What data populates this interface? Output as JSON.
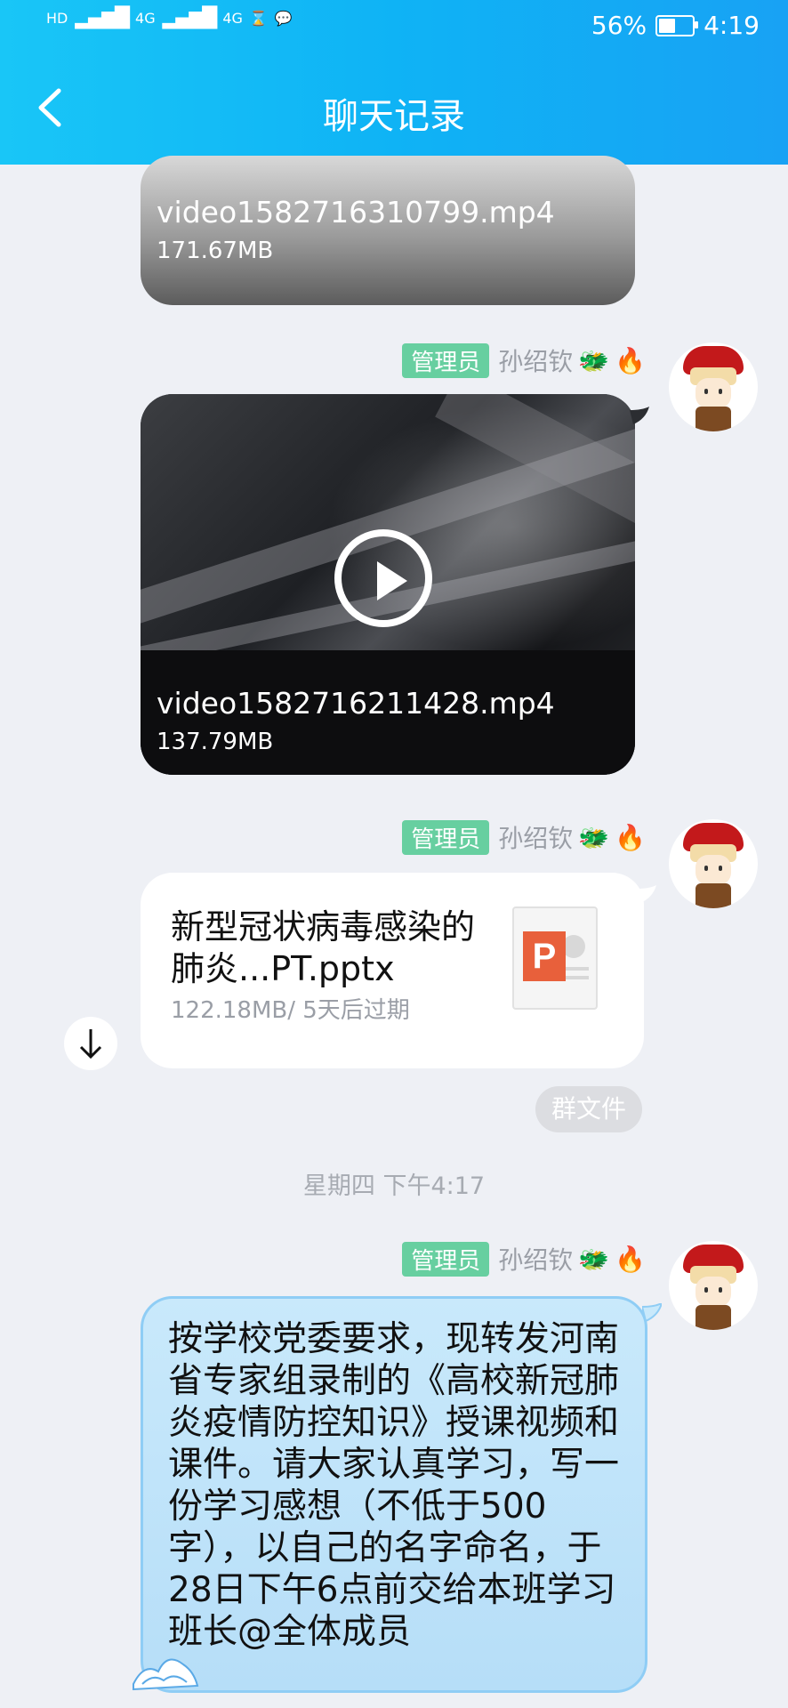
{
  "status_bar": {
    "left_labels": [
      "HD",
      "4G",
      "4G"
    ],
    "battery": "56%",
    "battery_level": 0.56,
    "time": "4:19"
  },
  "header": {
    "title": "聊天记录",
    "back_icon": "chevron-left-icon"
  },
  "messages": [
    {
      "type": "video",
      "file_name": "video1582716310799.mp4",
      "size": "171.67MB"
    },
    {
      "type": "video",
      "sender": {
        "badge": "管理员",
        "name": "孙绍钦"
      },
      "file_name": "video1582716211428.mp4",
      "size": "137.79MB",
      "play_icon": "play-icon"
    },
    {
      "type": "file",
      "sender": {
        "badge": "管理员",
        "name": "孙绍钦"
      },
      "file_name": "新型冠状病毒感染的肺炎...PT.pptx",
      "meta": "122.18MB/ 5天后过期",
      "file_icon": "ppt-file-icon",
      "tag": "群文件"
    }
  ],
  "timestamp": "星期四 下午4:17",
  "text_message": {
    "sender": {
      "badge": "管理员",
      "name": "孙绍钦"
    },
    "text": "按学校党委要求，现转发河南省专家组录制的《高校新冠肺炎疫情防控知识》授课视频和课件。请大家认真学习，写一份学习感想（不低于500字），以自己的名字命名，于28日下午6点前交给本班学习班长@全体成员"
  },
  "colors": {
    "header_start": "#19c6f7",
    "header_end": "#18a2f4",
    "admin_badge": "#67cfa0",
    "text_bubble": "#c9e9fb",
    "background": "#eef0f5"
  }
}
